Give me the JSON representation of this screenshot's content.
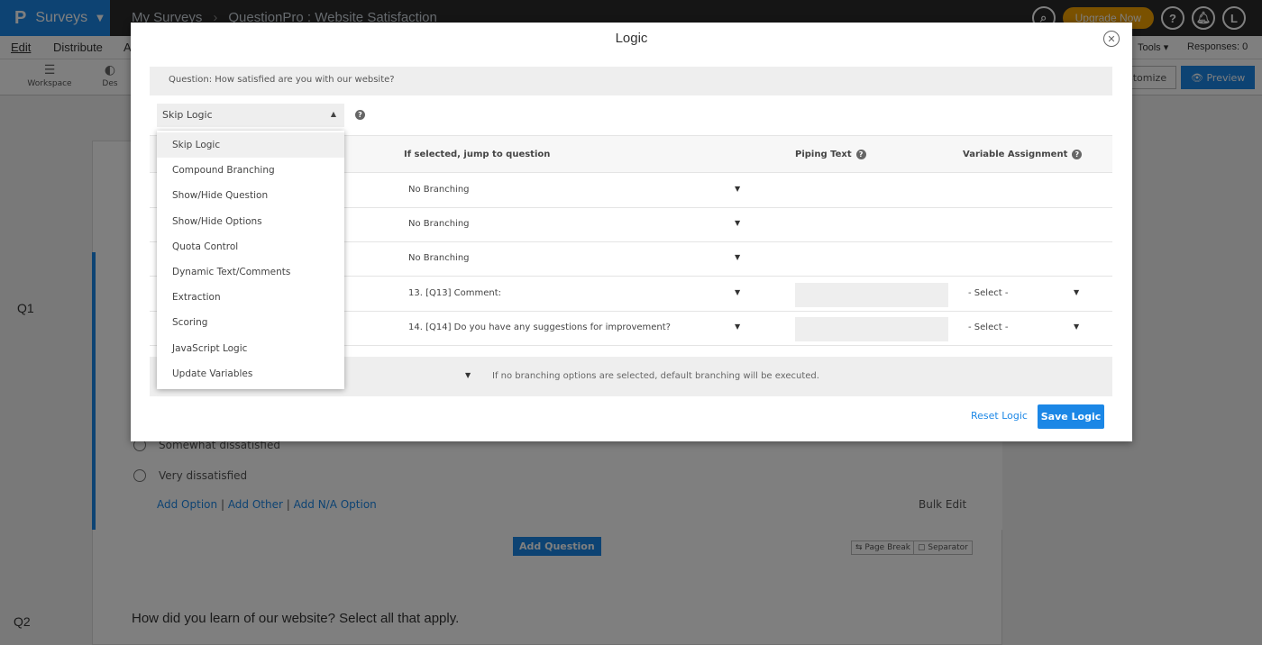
{
  "app": {
    "logo": "P",
    "name": "Surveys",
    "breadcrumb": [
      "My Surveys",
      "QuestionPro : Website Satisfaction"
    ],
    "upgrade_label": "Upgrade Now",
    "help_symbol": "?",
    "user_initial": "L"
  },
  "menubar": {
    "items": [
      "Edit",
      "Distribute",
      "A"
    ],
    "tools_label": "Tools ▾",
    "responses_label": "Responses: 0"
  },
  "toolbar": {
    "workspace_label": "Workspace",
    "design_label": "Des",
    "customize_label": "stomize",
    "preview_label": "Preview"
  },
  "canvas": {
    "q1_label": "Q1",
    "q2_label": "Q2",
    "options": [
      "Somewhat dissatisfied",
      "Very dissatisfied"
    ],
    "add_option": "Add Option",
    "add_other": "Add Other",
    "add_na": "Add N/A Option",
    "link_separator": "|",
    "bulk_edit": "Bulk Edit",
    "add_question": "Add Question",
    "page_break": "Page Break",
    "separator": "Separator",
    "q2_text": "How did you learn of our website? Select all that apply."
  },
  "modal": {
    "title": "Logic",
    "close_symbol": "✕",
    "question_text": "Question: How satisfied are you with our website?",
    "logic_type_selected": "Skip Logic",
    "help_symbol": "?",
    "headers": {
      "jump": "If selected, jump to question",
      "piping": "Piping Text",
      "variable": "Variable Assignment"
    },
    "rows": [
      {
        "jump": "No Branching",
        "has_extra": false
      },
      {
        "jump": "No Branching",
        "has_extra": false
      },
      {
        "jump": "No Branching",
        "has_extra": false
      },
      {
        "jump": "13. [Q13] Comment:",
        "has_extra": true,
        "var": "- Select -"
      },
      {
        "jump": "14. [Q14] Do you have any suggestions for improvement?",
        "has_extra": true,
        "var": "- Select -"
      }
    ],
    "default_note": "If no branching options are selected, default branching will be executed.",
    "reset_label": "Reset Logic",
    "save_label": "Save Logic"
  },
  "logic_menu": {
    "items": [
      "Skip Logic",
      "Compound Branching",
      "Show/Hide Question",
      "Show/Hide Options",
      "Quota Control",
      "Dynamic Text/Comments",
      "Extraction",
      "Scoring",
      "JavaScript Logic",
      "Update Variables"
    ],
    "highlighted_index": 0
  },
  "colors": {
    "brand": "#1b87e6",
    "upgrade": "#f5a300",
    "topbar": "#2a2a2a"
  }
}
